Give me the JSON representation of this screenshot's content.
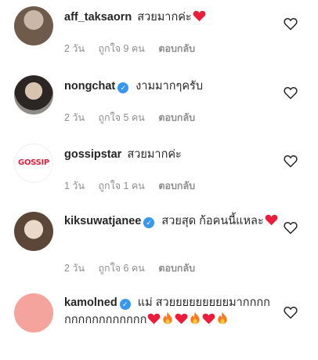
{
  "comments": [
    {
      "username": "aff_taksaorn",
      "verified": false,
      "text": "สวยมากค่ะ",
      "emojis": [
        "heart"
      ],
      "time": "2 วัน",
      "likes": "ถูกใจ 9 คน",
      "reply": "ตอบกลับ"
    },
    {
      "username": "nongchat",
      "verified": true,
      "text": "งามมากๆครับ",
      "emojis": [],
      "time": "2 วัน",
      "likes": "ถูกใจ 5 คน",
      "reply": "ตอบกลับ"
    },
    {
      "username": "gossipstar",
      "verified": false,
      "avatar_text": "GOSSIP",
      "text": "สวยมากค่ะ",
      "emojis": [],
      "time": "1 วัน",
      "likes": "ถูกใจ 1 คน",
      "reply": "ตอบกลับ"
    },
    {
      "username": "kiksuwatjanee",
      "verified": true,
      "text": "สวยสุด ก้อคนนี้แหละ",
      "emojis": [
        "heart"
      ],
      "time": "2 วัน",
      "likes": "ถูกใจ 6 คน",
      "reply": "ตอบกลับ"
    },
    {
      "username": "kamolned",
      "verified": true,
      "text": "แม่ สวยยยยยยยยยมากกกกกกกกกกกกกกกก",
      "emojis": [
        "heart",
        "fire",
        "heart",
        "fire",
        "heart",
        "fire"
      ],
      "time": "",
      "likes": "",
      "reply": ""
    }
  ],
  "colors": {
    "username": "#262626",
    "meta": "#8e8e8e",
    "verified": "#3897f0",
    "heart_emoji": "#ed1c3b",
    "fire_emoji": "#f97a1e"
  },
  "icons": {
    "like": "heart-outline-icon",
    "verified": "verified-badge-icon"
  }
}
